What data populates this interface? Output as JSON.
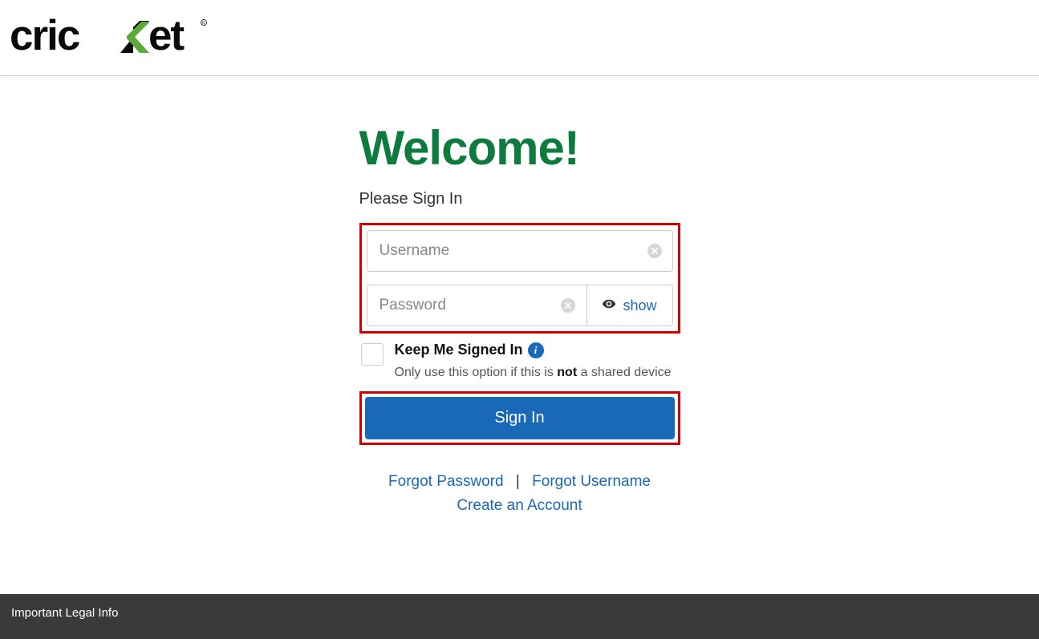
{
  "header": {
    "logo_text": "cricket"
  },
  "main": {
    "heading": "Welcome!",
    "subheading": "Please Sign In",
    "username_placeholder": "Username",
    "password_placeholder": "Password",
    "show_label": "show",
    "keep_signed_label": "Keep Me Signed In",
    "keep_signed_note_pre": "Only use this option if this is ",
    "keep_signed_note_bold": "not",
    "keep_signed_note_post": " a shared device",
    "signin_label": "Sign In",
    "forgot_password": "Forgot Password",
    "forgot_username": "Forgot Username",
    "create_account": "Create an Account",
    "separator": "|"
  },
  "footer": {
    "legal_info": "Important Legal Info"
  }
}
